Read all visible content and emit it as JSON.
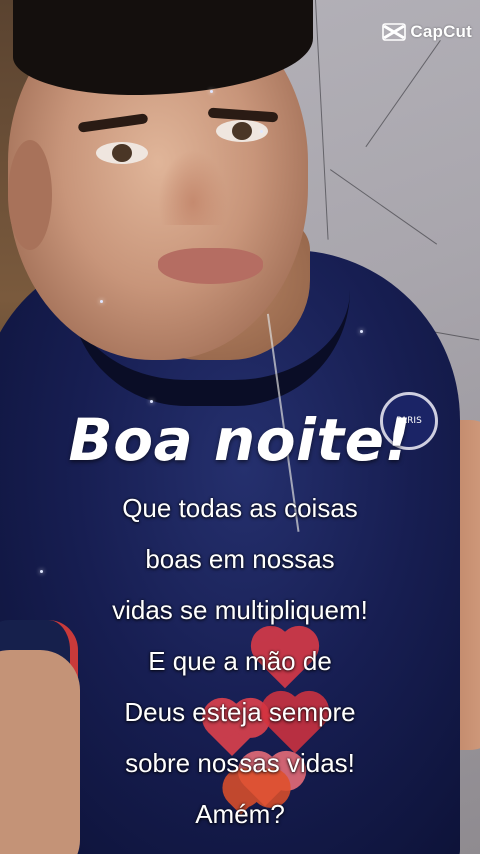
{
  "app": {
    "watermark_text": "CapCut",
    "watermark_icon": "capcut-logo-icon"
  },
  "greeting": {
    "title": "Boa noite!"
  },
  "message": {
    "lines": [
      "Que todas as coisas",
      "boas em nossas",
      "vidas se multipliquem!",
      "E que a mão de",
      "Deus esteja sempre",
      "sobre nossas vidas!",
      "Amém?"
    ]
  },
  "colors": {
    "text": "#ffffff",
    "heart": "#e8434c",
    "shirt": "#171e52"
  }
}
